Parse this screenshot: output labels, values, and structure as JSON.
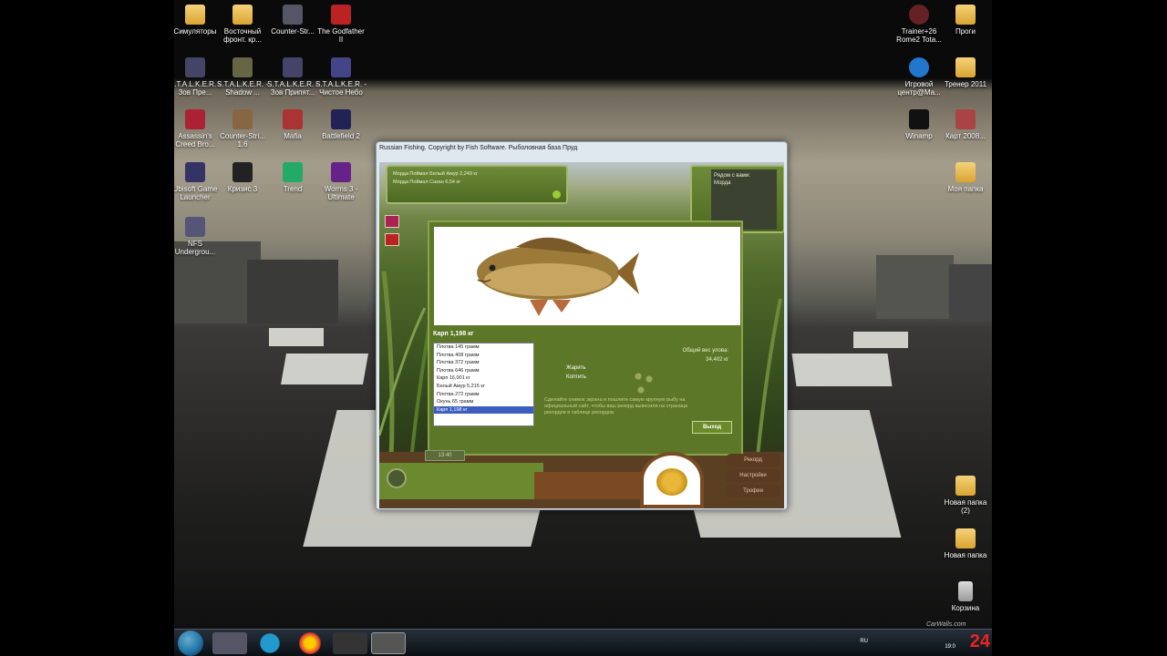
{
  "desktop": {
    "icons_left": [
      {
        "label": "Симуляторы"
      },
      {
        "label": "Восточный фронт. кр..."
      },
      {
        "label": "Counter-Str..."
      },
      {
        "label": "The Godfather II"
      },
      {
        "label": "S.T.A.L.K.E.R. - Зов Пре..."
      },
      {
        "label": "S.T.A.L.K.E.R. - Shadow ..."
      },
      {
        "label": "S.T.A.L.K.E.R. - Зов Припят..."
      },
      {
        "label": "S.T.A.L.K.E.R. - Чистое Небо"
      },
      {
        "label": "Assassin's Creed Bro..."
      },
      {
        "label": "Counter-Stri... 1.6"
      },
      {
        "label": "Mafia"
      },
      {
        "label": "Battlefield 2"
      },
      {
        "label": "Ubisoft Game Launcher"
      },
      {
        "label": "Кризис 3"
      },
      {
        "label": "Trend"
      },
      {
        "label": "Worms 3 - Ultimate"
      },
      {
        "label": "NFS Undergrou..."
      }
    ],
    "icons_right": [
      {
        "label": "Trainer+26 Rome2 Tota..."
      },
      {
        "label": "Проги"
      },
      {
        "label": "Игровой центр@Ma..."
      },
      {
        "label": "Тренер 2011"
      },
      {
        "label": "Winamp"
      },
      {
        "label": "Карт 2008..."
      },
      {
        "label": "Моя папка"
      },
      {
        "label": "Новая папка (2)"
      },
      {
        "label": "Новая папка"
      },
      {
        "label": "Корзина"
      }
    ],
    "watermark": "CarWalls.com"
  },
  "game": {
    "title": "Russian Fishing. Copyright by Fish Software. Рыболовная база Пруд",
    "notices": [
      "Морда Поймал Белый Амур 2,249 кг",
      "Морда Поймал Сазан 6,54 кг"
    ],
    "nearby_title": "Рядом с вами:",
    "nearby_player": "Морда",
    "fish_name": "Карп 1,198 кг",
    "catch_list": [
      "Плотва 145 грамм",
      "Плотва 408 грамм",
      "Плотва 372 грамм",
      "Плотва 646 грамм",
      "Карп 16,001 кг",
      "Белый Амур 5,215 кг",
      "Плотва 272 грамм",
      "Окунь 65 грамм",
      "Карп 1,198 кг"
    ],
    "selected_index": 8,
    "option_fry": "Жарить",
    "option_sell": "Коптить",
    "total_label": "Общий вес улова:",
    "total_value": "34,402 кг",
    "tip": "Сделайте снимок экрана и пошлите самую крупную рыбу на официальный сайт, чтобы ваш рекорд вывесили на странице рекордов в таблице рекордов.",
    "exit_button": "Выход",
    "clock": "13:40",
    "menu": [
      "Рекорд",
      "Настройки",
      "Трофеи"
    ]
  },
  "taskbar": {
    "lang": "RU",
    "time": "19:0",
    "corner_number": "24"
  },
  "colors": {
    "panel_green": "#5d7728",
    "selection": "#3b5fbf",
    "button_border": "#c8d890"
  }
}
